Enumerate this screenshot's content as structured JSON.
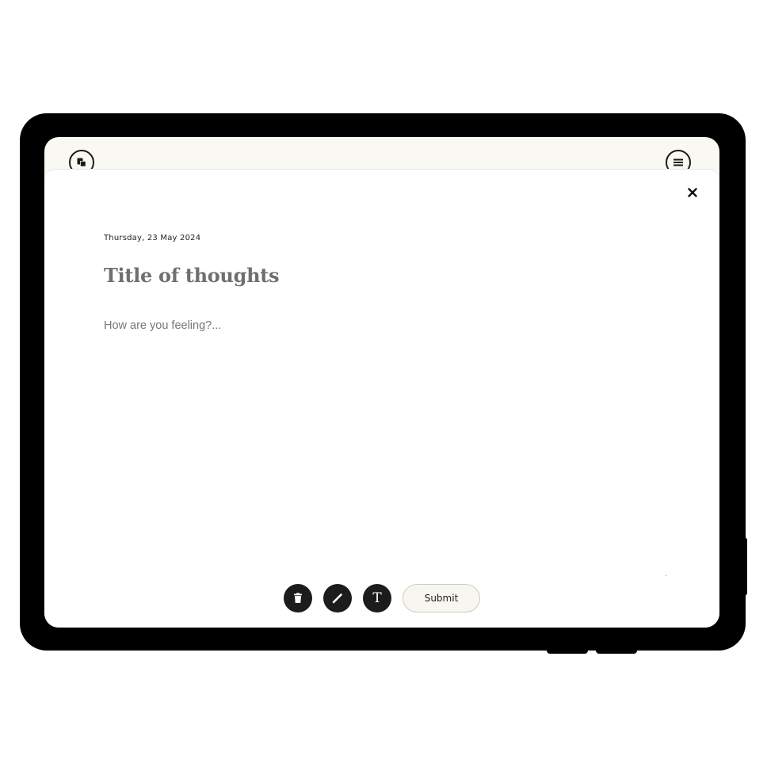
{
  "header": {
    "left_icon": "copy-icon",
    "right_icon": "menu-icon"
  },
  "entry": {
    "close_icon": "close-icon",
    "date": "Thursday, 23 May 2024",
    "title": "Title of thoughts",
    "body_placeholder": "How are you feeling?..."
  },
  "toolbar": {
    "delete_icon": "trash-icon",
    "draw_icon": "pen-icon",
    "text_icon": "text-icon",
    "text_glyph": "T",
    "submit_label": "Submit"
  },
  "colors": {
    "device_frame": "#000000",
    "screen_background": "#f9f8f3",
    "sheet_background": "#ffffff",
    "title_color": "#6f6f6f",
    "tool_button": "#1c1c1c"
  }
}
